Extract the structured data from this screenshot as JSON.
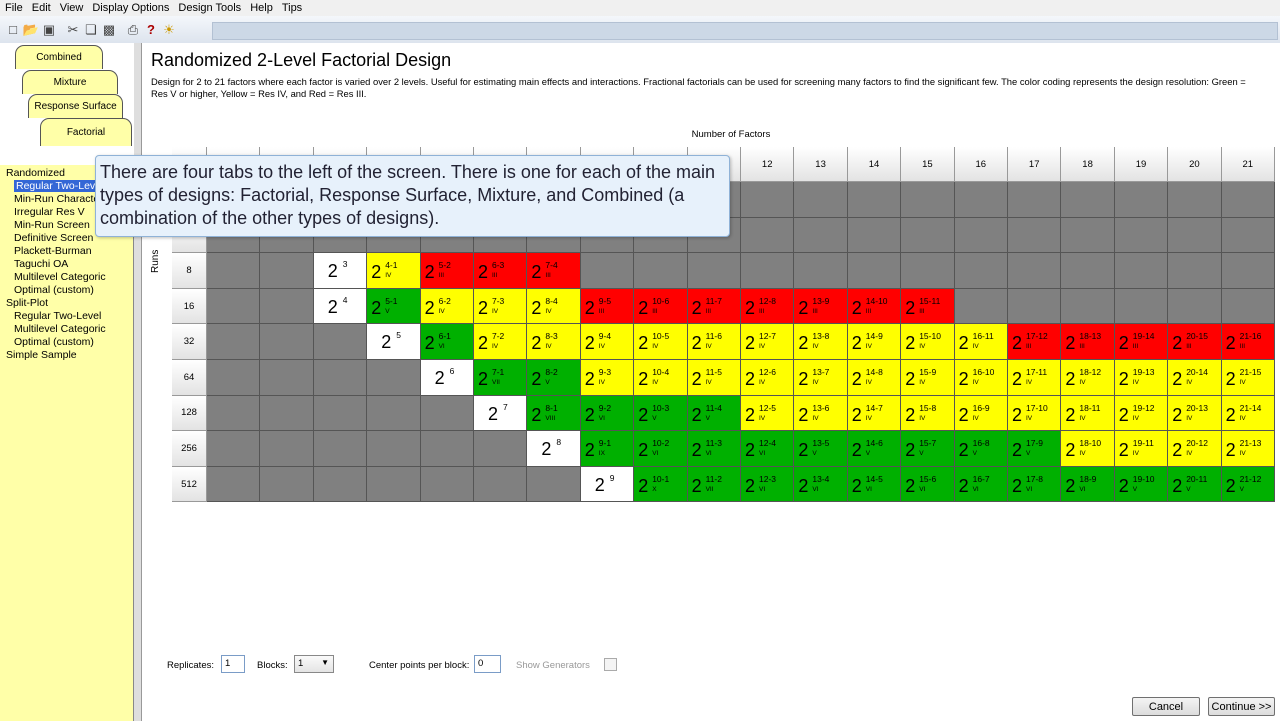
{
  "menu": [
    "File",
    "Edit",
    "View",
    "Display Options",
    "Design Tools",
    "Help",
    "Tips"
  ],
  "tabs": {
    "combined": "Combined",
    "mixture": "Mixture",
    "response_surface": "Response Surface",
    "factorial": "Factorial"
  },
  "tree": [
    {
      "label": "Randomized",
      "level": 0
    },
    {
      "label": "Regular Two-Level",
      "level": 1,
      "selected": true
    },
    {
      "label": "Min-Run Characterize",
      "level": 1
    },
    {
      "label": "Irregular Res V",
      "level": 1
    },
    {
      "label": "Min-Run Screen",
      "level": 1
    },
    {
      "label": "Definitive Screen",
      "level": 1
    },
    {
      "label": "Plackett-Burman",
      "level": 1
    },
    {
      "label": "Taguchi OA",
      "level": 1
    },
    {
      "label": "Multilevel Categoric",
      "level": 1
    },
    {
      "label": "Optimal (custom)",
      "level": 1
    },
    {
      "label": "Split-Plot",
      "level": 0
    },
    {
      "label": "Regular Two-Level",
      "level": 1
    },
    {
      "label": "Multilevel Categoric",
      "level": 1
    },
    {
      "label": "Optimal (custom)",
      "level": 1
    },
    {
      "label": "Simple Sample",
      "level": 0
    }
  ],
  "main": {
    "title": "Randomized 2-Level Factorial Design",
    "description": "Design for 2 to 21 factors where each factor is varied over 2 levels.  Useful for estimating main effects and interactions.  Fractional factorials can be used for screening many factors to find the significant few. The color coding represents the design resolution: Green = Res V or higher, Yellow = Res IV, and Red = Res III.",
    "factors_label": "Number of Factors",
    "runs_label": "Runs"
  },
  "factors": [
    "",
    "",
    "",
    "",
    "",
    "",
    "",
    "",
    "",
    "",
    "12",
    "13",
    "14",
    "15",
    "16",
    "17",
    "18",
    "19",
    "20",
    "21"
  ],
  "runs": [
    "",
    "",
    "8",
    "16",
    "32",
    "64",
    "128",
    "256",
    "512"
  ],
  "colors": {
    "green": "#00b000",
    "yellow": "#ffff00",
    "red": "#ff0000",
    "gray": "#808080"
  },
  "grid": {
    "8": [
      [
        "g"
      ],
      [
        "g"
      ],
      [
        "w",
        "3",
        ""
      ],
      [
        "y",
        "4-1",
        "IV"
      ],
      [
        "r",
        "5-2",
        "III"
      ],
      [
        "r",
        "6-3",
        "III"
      ],
      [
        "r",
        "7-4",
        "III"
      ],
      [
        "g"
      ],
      [
        "g"
      ],
      [
        "g"
      ],
      [
        "g"
      ],
      [
        "g"
      ],
      [
        "g"
      ],
      [
        "g"
      ],
      [
        "g"
      ],
      [
        "g"
      ],
      [
        "g"
      ],
      [
        "g"
      ],
      [
        "g"
      ],
      [
        "g"
      ]
    ],
    "16": [
      [
        "g"
      ],
      [
        "g"
      ],
      [
        "w",
        "4",
        ""
      ],
      [
        "G",
        "5-1",
        "V"
      ],
      [
        "y",
        "6-2",
        "IV"
      ],
      [
        "y",
        "7-3",
        "IV"
      ],
      [
        "y",
        "8-4",
        "IV"
      ],
      [
        "r",
        "9-5",
        "III"
      ],
      [
        "r",
        "10-6",
        "III"
      ],
      [
        "r",
        "11-7",
        "III"
      ],
      [
        "r",
        "12-8",
        "III"
      ],
      [
        "r",
        "13-9",
        "III"
      ],
      [
        "r",
        "14-10",
        "III"
      ],
      [
        "r",
        "15-11",
        "III"
      ],
      [
        "g"
      ],
      [
        "g"
      ],
      [
        "g"
      ],
      [
        "g"
      ],
      [
        "g"
      ],
      [
        "g"
      ]
    ],
    "32": [
      [
        "g"
      ],
      [
        "g"
      ],
      [
        "g"
      ],
      [
        "w",
        "5",
        ""
      ],
      [
        "G",
        "6-1",
        "VI"
      ],
      [
        "y",
        "7-2",
        "IV"
      ],
      [
        "y",
        "8-3",
        "IV"
      ],
      [
        "y",
        "9-4",
        "IV"
      ],
      [
        "y",
        "10-5",
        "IV"
      ],
      [
        "y",
        "11-6",
        "IV"
      ],
      [
        "y",
        "12-7",
        "IV"
      ],
      [
        "y",
        "13-8",
        "IV"
      ],
      [
        "y",
        "14-9",
        "IV"
      ],
      [
        "y",
        "15-10",
        "IV"
      ],
      [
        "y",
        "16-11",
        "IV"
      ],
      [
        "r",
        "17-12",
        "III"
      ],
      [
        "r",
        "18-13",
        "III"
      ],
      [
        "r",
        "19-14",
        "III"
      ],
      [
        "r",
        "20-15",
        "III"
      ],
      [
        "r",
        "21-16",
        "III"
      ]
    ],
    "64": [
      [
        "g"
      ],
      [
        "g"
      ],
      [
        "g"
      ],
      [
        "g"
      ],
      [
        "w",
        "6",
        ""
      ],
      [
        "G",
        "7-1",
        "VII"
      ],
      [
        "G",
        "8-2",
        "V"
      ],
      [
        "y",
        "9-3",
        "IV"
      ],
      [
        "y",
        "10-4",
        "IV"
      ],
      [
        "y",
        "11-5",
        "IV"
      ],
      [
        "y",
        "12-6",
        "IV"
      ],
      [
        "y",
        "13-7",
        "IV"
      ],
      [
        "y",
        "14-8",
        "IV"
      ],
      [
        "y",
        "15-9",
        "IV"
      ],
      [
        "y",
        "16-10",
        "IV"
      ],
      [
        "y",
        "17-11",
        "IV"
      ],
      [
        "y",
        "18-12",
        "IV"
      ],
      [
        "y",
        "19-13",
        "IV"
      ],
      [
        "y",
        "20-14",
        "IV"
      ],
      [
        "y",
        "21-15",
        "IV"
      ]
    ],
    "128": [
      [
        "g"
      ],
      [
        "g"
      ],
      [
        "g"
      ],
      [
        "g"
      ],
      [
        "g"
      ],
      [
        "w",
        "7",
        ""
      ],
      [
        "G",
        "8-1",
        "VIII"
      ],
      [
        "G",
        "9-2",
        "VI"
      ],
      [
        "G",
        "10-3",
        "V"
      ],
      [
        "G",
        "11-4",
        "V"
      ],
      [
        "y",
        "12-5",
        "IV"
      ],
      [
        "y",
        "13-6",
        "IV"
      ],
      [
        "y",
        "14-7",
        "IV"
      ],
      [
        "y",
        "15-8",
        "IV"
      ],
      [
        "y",
        "16-9",
        "IV"
      ],
      [
        "y",
        "17-10",
        "IV"
      ],
      [
        "y",
        "18-11",
        "IV"
      ],
      [
        "y",
        "19-12",
        "IV"
      ],
      [
        "y",
        "20-13",
        "IV"
      ],
      [
        "y",
        "21-14",
        "IV"
      ]
    ],
    "256": [
      [
        "g"
      ],
      [
        "g"
      ],
      [
        "g"
      ],
      [
        "g"
      ],
      [
        "g"
      ],
      [
        "g"
      ],
      [
        "w",
        "8",
        ""
      ],
      [
        "G",
        "9-1",
        "IX"
      ],
      [
        "G",
        "10-2",
        "VI"
      ],
      [
        "G",
        "11-3",
        "VI"
      ],
      [
        "G",
        "12-4",
        "VI"
      ],
      [
        "G",
        "13-5",
        "V"
      ],
      [
        "G",
        "14-6",
        "V"
      ],
      [
        "G",
        "15-7",
        "V"
      ],
      [
        "G",
        "16-8",
        "V"
      ],
      [
        "G",
        "17-9",
        "V"
      ],
      [
        "y",
        "18-10",
        "IV"
      ],
      [
        "y",
        "19-11",
        "IV"
      ],
      [
        "y",
        "20-12",
        "IV"
      ],
      [
        "y",
        "21-13",
        "IV"
      ]
    ],
    "512": [
      [
        "g"
      ],
      [
        "g"
      ],
      [
        "g"
      ],
      [
        "g"
      ],
      [
        "g"
      ],
      [
        "g"
      ],
      [
        "g"
      ],
      [
        "w",
        "9",
        ""
      ],
      [
        "G",
        "10-1",
        "X"
      ],
      [
        "G",
        "11-2",
        "VII"
      ],
      [
        "G",
        "12-3",
        "VI"
      ],
      [
        "G",
        "13-4",
        "VI"
      ],
      [
        "G",
        "14-5",
        "VI"
      ],
      [
        "G",
        "15-6",
        "VI"
      ],
      [
        "G",
        "16-7",
        "VI"
      ],
      [
        "G",
        "17-8",
        "VI"
      ],
      [
        "G",
        "18-9",
        "VI"
      ],
      [
        "G",
        "19-10",
        "V"
      ],
      [
        "G",
        "20-11",
        "V"
      ],
      [
        "G",
        "21-12",
        "V"
      ]
    ]
  },
  "controls": {
    "replicates_label": "Replicates:",
    "replicates_value": "1",
    "blocks_label": "Blocks:",
    "blocks_value": "1",
    "center_label": "Center points per block:",
    "center_value": "0",
    "show_generators_label": "Show Generators"
  },
  "buttons": {
    "cancel": "Cancel",
    "continue": "Continue >>"
  },
  "tooltip": "There are four tabs to the left of the screen.  There is one for each of the main types of designs: Factorial, Response Surface, Mixture, and Combined (a combination of the other types of designs)."
}
